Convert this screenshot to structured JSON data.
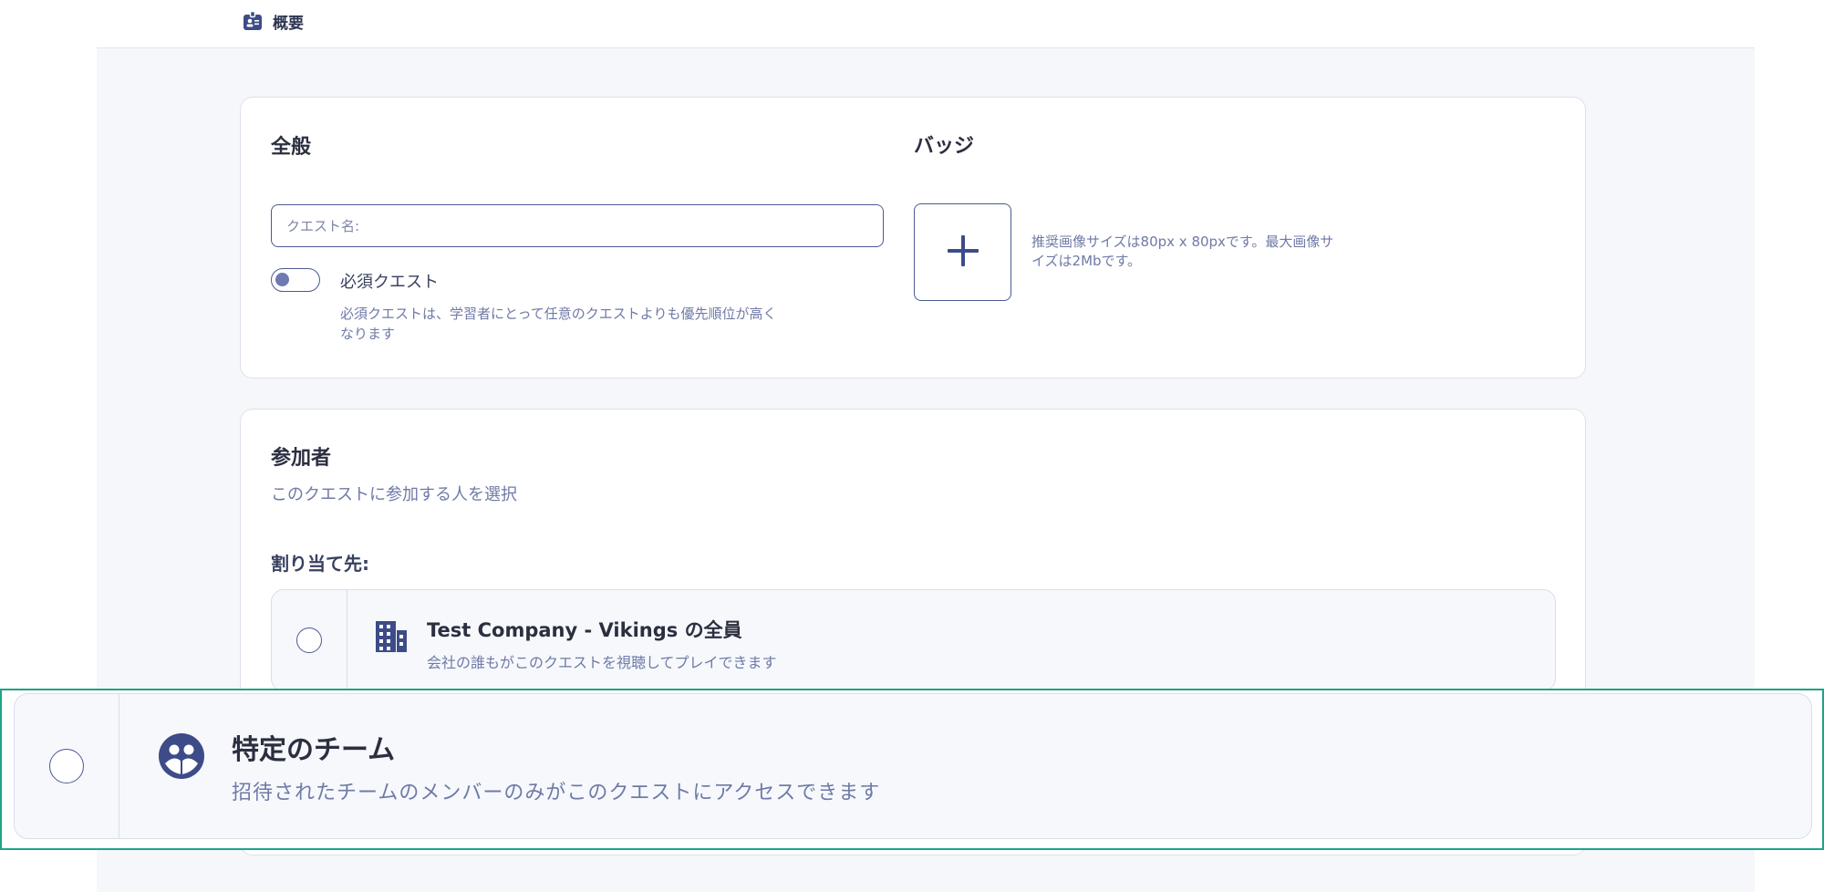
{
  "header": {
    "overview_tab": {
      "label": "概要",
      "icon": "id-badge-icon"
    }
  },
  "general": {
    "title": "全般",
    "quest_name": {
      "placeholder": "クエスト名:",
      "value": ""
    },
    "required_toggle": {
      "label": "必須クエスト",
      "state": "off",
      "help": "必須クエストは、学習者にとって任意のクエストよりも優先順位が高くなります"
    }
  },
  "badge": {
    "title": "バッジ",
    "add_icon": "plus-icon",
    "help": "推奨画像サイズは80px x 80pxです。最大画像サイズは2Mbです。"
  },
  "participants": {
    "title": "参加者",
    "subtitle": "このクエストに参加する人を選択",
    "assign_label": "割り当て先:",
    "options": [
      {
        "title": "Test Company - Vikings の全員",
        "desc": "会社の誰もがこのクエストを視聴してプレイできます",
        "icon": "building-icon",
        "selected": false
      },
      {
        "title": "特定のチーム",
        "desc": "招待されたチームのメンバーのみがこのクエストにアクセスできます",
        "icon": "team-icon",
        "selected": false
      }
    ]
  },
  "colors": {
    "accent": "#4a5a94",
    "muted_text": "#6f7aa6",
    "highlight": "#1fa386",
    "background": "#f6f7fa"
  }
}
